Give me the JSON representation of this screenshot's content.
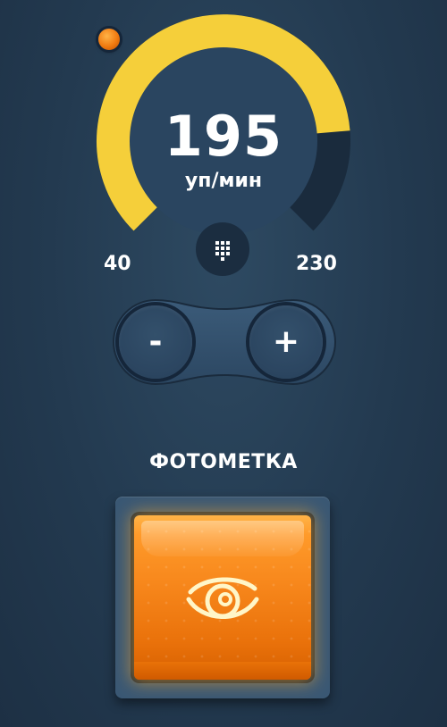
{
  "status_indicator": {
    "color": "#f07a10"
  },
  "tempo_gauge": {
    "value": "195",
    "unit": "уп/мин",
    "min_label": "40",
    "max_label": "230",
    "min": 40,
    "max": 230,
    "current": 195,
    "fill_color": "#f5cf3a",
    "track_color": "#1a2b3d"
  },
  "keypad": {
    "icon": "keypad-icon"
  },
  "stepper": {
    "decrease_label": "-",
    "increase_label": "+"
  },
  "photo_mark": {
    "title": "ФОТОМЕТКА",
    "icon": "eye-icon",
    "color": "#f6851a"
  }
}
